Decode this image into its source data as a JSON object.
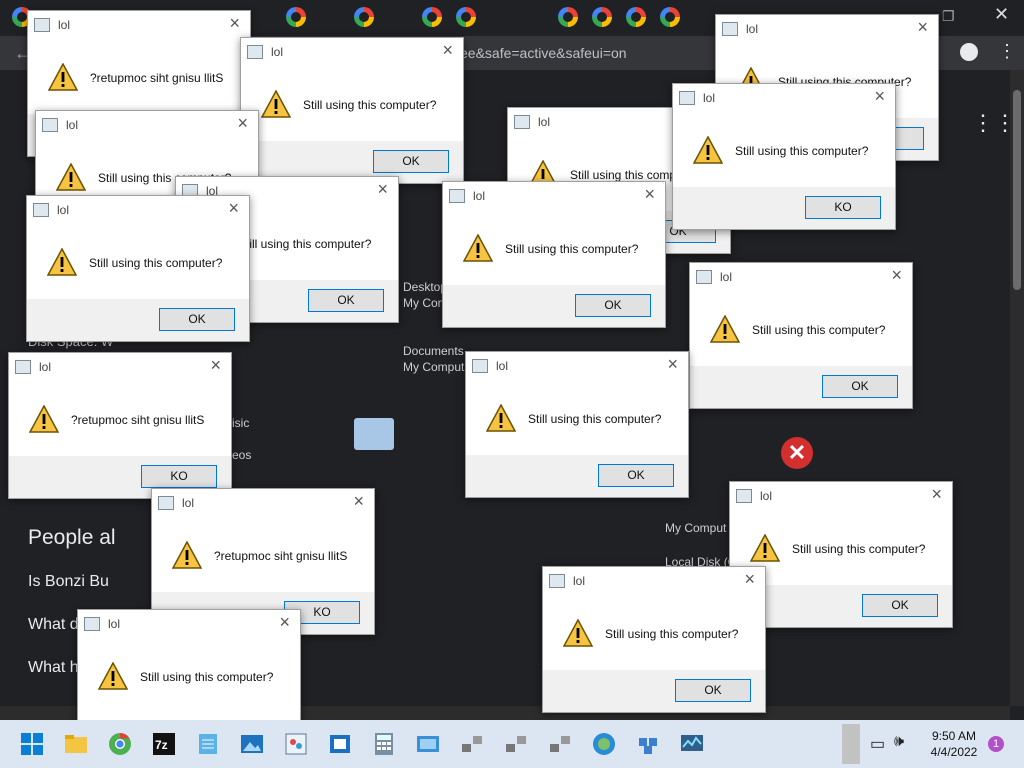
{
  "browser": {
    "url_text": "ee&safe=active&safeui=on",
    "bg_texts": {
      "desktop": "Desktop",
      "mycomp1": "My Com",
      "documents": "Documents",
      "mycomp2": "My Comput",
      "disk_space": "Disk Space: W",
      "music": "isic",
      "videos": "eos",
      "people_also": "People al",
      "is_bonzi": "Is Bonzi Bu",
      "what1": "What d",
      "what2": "What h",
      "mycomputer": "My Comput",
      "localdisk": "Local Disk (C"
    }
  },
  "dialogs": [
    {
      "title": "lol",
      "message": "?retupmoc siht gnisu llitS",
      "button": "OK"
    },
    {
      "title": "lol",
      "message": "Still using this computer?",
      "button": "OK"
    },
    {
      "title": "lol",
      "message": "Still using this computer?",
      "button": "OK"
    },
    {
      "title": "lol",
      "message": "Still using this computer?",
      "button": "OK"
    },
    {
      "title": "lol",
      "message": "Still using this computer?",
      "button": "OK"
    },
    {
      "title": "lol",
      "message": "Still using this computer?",
      "button": "KO"
    },
    {
      "title": "lol",
      "message": "Still using this computer?",
      "button": "OK"
    },
    {
      "title": "lol",
      "message": "?retupmoc siht gnisu llitS",
      "button": "KO"
    },
    {
      "title": "lol",
      "message": "Still using this computer?",
      "button": "OK"
    },
    {
      "title": "lol",
      "message": "Still using this computer?",
      "button": "OK"
    },
    {
      "title": "lol",
      "message": "?retupmoc siht gnisu llitS",
      "button": "KO"
    },
    {
      "title": "lol",
      "message": "Still using this computer?",
      "button": "OK"
    },
    {
      "title": "lol",
      "message": "Still using this computer?",
      "button": "OK"
    },
    {
      "title": "lol",
      "message": "Still using this computer?",
      "button": "OK"
    },
    {
      "title": "lol",
      "message": "Still using this computer?",
      "button": "OK"
    }
  ],
  "taskbar": {
    "time": "9:50 AM",
    "date": "4/4/2022",
    "notification_count": "1",
    "icons": [
      "start-icon",
      "file-explorer-icon",
      "chrome-icon",
      "sevenzip-icon",
      "notepad-icon",
      "photos-icon",
      "paint-icon",
      "app-icon",
      "calculator-icon",
      "control-panel-icon",
      "network-icon",
      "network-icon",
      "network-icon",
      "browser-icon",
      "puzzle-icon",
      "monitor-icon"
    ]
  },
  "colors": {
    "accent": "#0078d7",
    "taskbar": "#dbe6f2",
    "browser_bg": "#202124"
  }
}
